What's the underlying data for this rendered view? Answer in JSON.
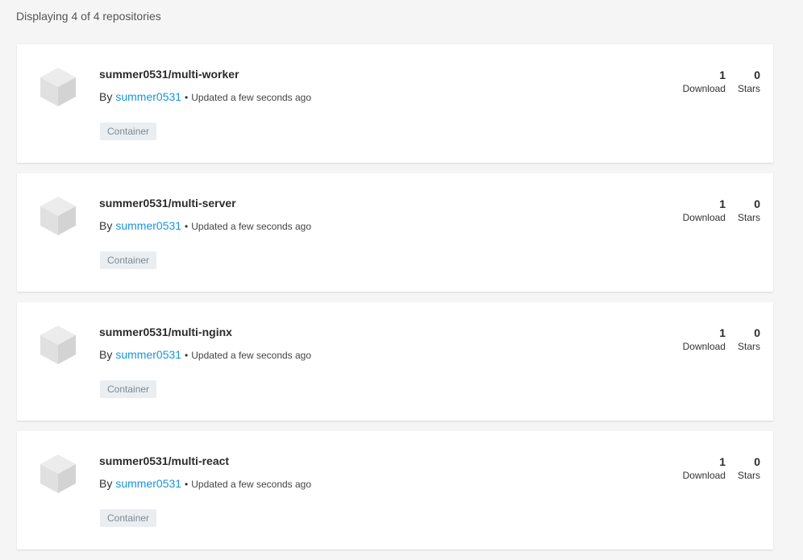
{
  "summary": "Displaying 4 of 4 repositories",
  "repos": [
    {
      "name": "summer0531/multi-worker",
      "by": "By",
      "owner": "summer0531",
      "separator": "•",
      "updated": "Updated a few seconds ago",
      "tag": "Container",
      "downloads": "1",
      "downloads_label": "Download",
      "stars": "0",
      "stars_label": "Stars"
    },
    {
      "name": "summer0531/multi-server",
      "by": "By",
      "owner": "summer0531",
      "separator": "•",
      "updated": "Updated a few seconds ago",
      "tag": "Container",
      "downloads": "1",
      "downloads_label": "Download",
      "stars": "0",
      "stars_label": "Stars"
    },
    {
      "name": "summer0531/multi-nginx",
      "by": "By",
      "owner": "summer0531",
      "separator": "•",
      "updated": "Updated a few seconds ago",
      "tag": "Container",
      "downloads": "1",
      "downloads_label": "Download",
      "stars": "0",
      "stars_label": "Stars"
    },
    {
      "name": "summer0531/multi-react",
      "by": "By",
      "owner": "summer0531",
      "separator": "•",
      "updated": "Updated a few seconds ago",
      "tag": "Container",
      "downloads": "1",
      "downloads_label": "Download",
      "stars": "0",
      "stars_label": "Stars"
    }
  ],
  "icon": "cube-icon",
  "colors": {
    "owner_link": "#1796d8",
    "tag_bg": "#eaeef1",
    "page_bg": "#f5f5f5"
  }
}
